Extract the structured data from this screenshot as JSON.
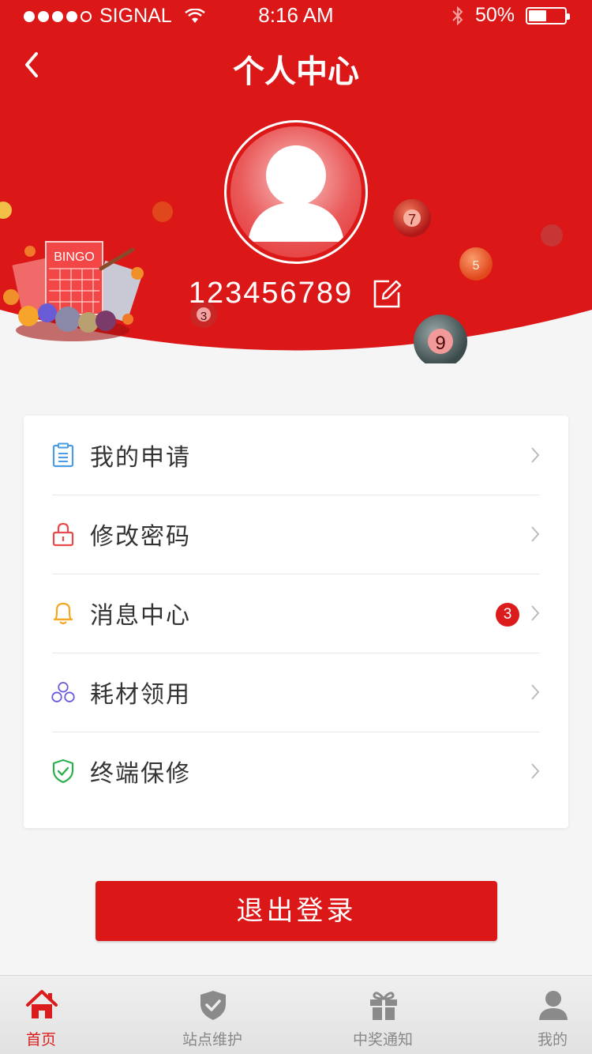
{
  "status_bar": {
    "carrier": "SIGNAL",
    "time": "8:16 AM",
    "battery": "50%",
    "battery_level": 0.5
  },
  "header": {
    "title": "个人中心",
    "username": "123456789",
    "decor_bingo_text": "BINGO",
    "decor_ball_numbers": [
      "7",
      "5",
      "3",
      "9"
    ]
  },
  "menu": {
    "items": [
      {
        "label": "我的申请",
        "icon": "clipboard-icon",
        "color": "#4a9be8"
      },
      {
        "label": "修改密码",
        "icon": "lock-icon",
        "color": "#e84a4a"
      },
      {
        "label": "消息中心",
        "icon": "bell-icon",
        "color": "#f5a623",
        "badge": "3"
      },
      {
        "label": "耗材领用",
        "icon": "circles-icon",
        "color": "#6a5bd6"
      },
      {
        "label": "终端保修",
        "icon": "shield-check-icon",
        "color": "#2cb04d"
      }
    ]
  },
  "logout_label": "退出登录",
  "tabs": [
    {
      "label": "首页",
      "icon": "home-icon",
      "active": true
    },
    {
      "label": "站点维护",
      "icon": "shield-icon",
      "active": false
    },
    {
      "label": "中奖通知",
      "icon": "gift-icon",
      "active": false
    },
    {
      "label": "我的",
      "icon": "user-icon",
      "active": false
    }
  ],
  "colors": {
    "primary": "#dc1717",
    "background": "#f5f5f5",
    "text": "#333333",
    "tab_inactive": "#888888"
  }
}
